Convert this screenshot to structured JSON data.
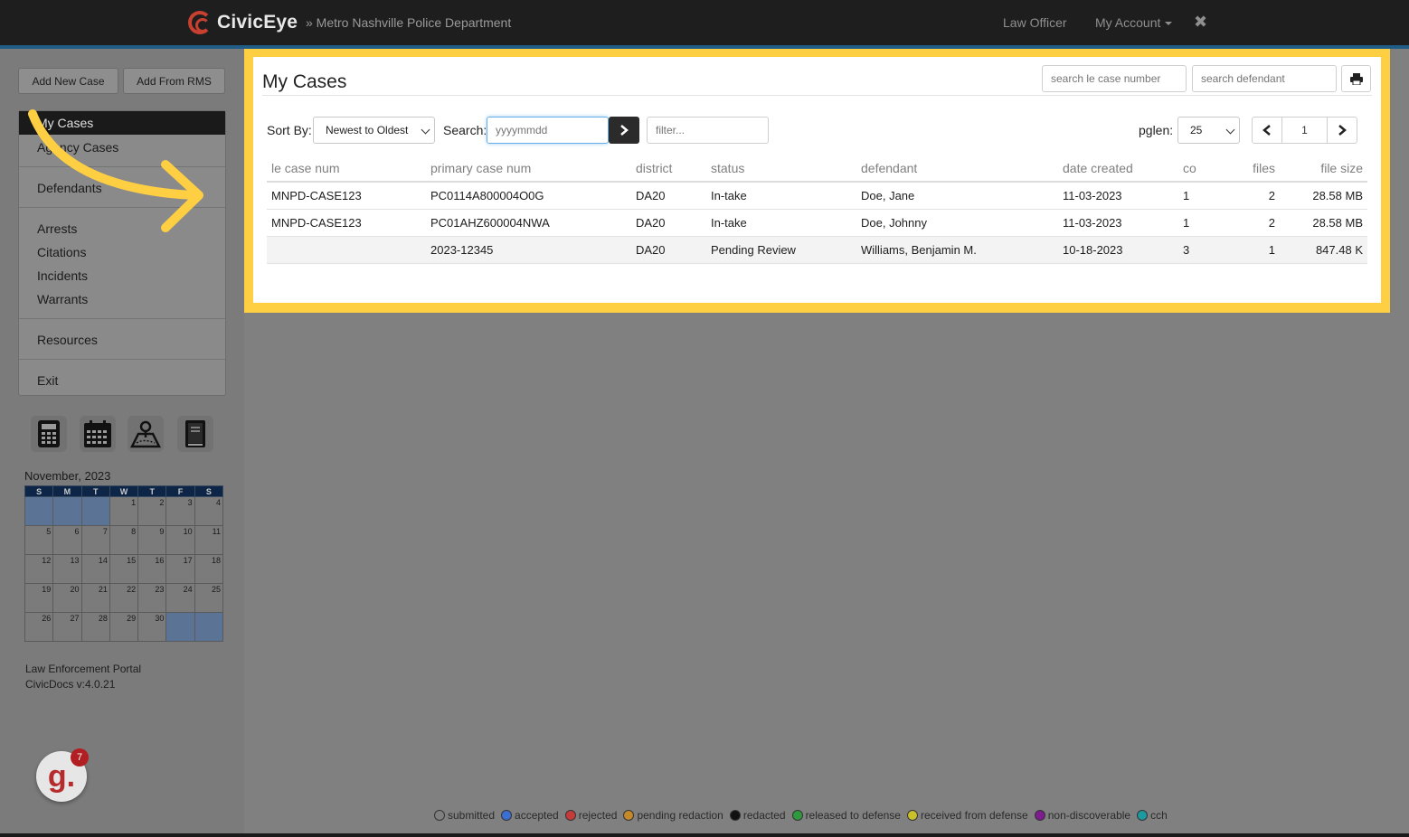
{
  "header": {
    "brand": "CivicEye",
    "department": "» Metro Nashville Police Department",
    "role": "Law Officer",
    "account": "My Account",
    "close_glyph": "✖"
  },
  "sidebar": {
    "add_new_case": "Add New Case",
    "add_from_rms": "Add From RMS",
    "menu": [
      {
        "label": "My Cases"
      },
      {
        "label": "Agency Cases"
      },
      {
        "label": "Defendants"
      },
      {
        "label": "Arrests"
      },
      {
        "label": "Citations"
      },
      {
        "label": "Incidents"
      },
      {
        "label": "Warrants"
      },
      {
        "label": "Resources"
      },
      {
        "label": "Exit"
      }
    ],
    "tools": [
      "calculator-icon",
      "calendar-icon",
      "map-icon",
      "book-icon"
    ],
    "calendar": {
      "title": "November, 2023",
      "days": [
        "S",
        "M",
        "T",
        "W",
        "T",
        "F",
        "S"
      ],
      "weeks": [
        [
          "",
          "",
          "",
          "1",
          "2",
          "3",
          "4"
        ],
        [
          "5",
          "6",
          "7",
          "8",
          "9",
          "10",
          "11"
        ],
        [
          "12",
          "13",
          "14",
          "15",
          "16",
          "17",
          "18"
        ],
        [
          "19",
          "20",
          "21",
          "22",
          "23",
          "24",
          "25"
        ],
        [
          "26",
          "27",
          "28",
          "29",
          "30",
          "",
          ""
        ]
      ]
    },
    "footer_line1": "Law Enforcement Portal",
    "footer_line2": "CivicDocs v:4.0.21",
    "badge_letter": "g.",
    "badge_count": "7"
  },
  "main": {
    "title": "My Cases",
    "search_case_placeholder": "search le case number",
    "search_defendant_placeholder": "search defendant",
    "sort_label": "Sort By:",
    "sort_value": "Newest to Oldest",
    "search_label": "Search:",
    "date_placeholder": "yyyymmdd",
    "filter_placeholder": "filter...",
    "pglen_label": "pglen:",
    "pglen_value": "25",
    "page_number": "1",
    "columns": [
      "le case num",
      "primary case num",
      "district",
      "status",
      "defendant",
      "date created",
      "co",
      "files",
      "file size"
    ],
    "rows": [
      {
        "le": "MNPD-CASE123",
        "primary": "PC0114A800004O0G",
        "district": "DA20",
        "status": "In-take",
        "defendant": "Doe, Jane",
        "date": "11-03-2023",
        "co": "1",
        "files": "2",
        "size": "28.58 MB"
      },
      {
        "le": "MNPD-CASE123",
        "primary": "PC01AHZ600004NWA",
        "district": "DA20",
        "status": "In-take",
        "defendant": "Doe, Johnny",
        "date": "11-03-2023",
        "co": "1",
        "files": "2",
        "size": "28.58 MB"
      },
      {
        "le": "",
        "primary": "2023-12345",
        "district": "DA20",
        "status": "Pending Review",
        "defendant": "Williams, Benjamin M.",
        "date": "10-18-2023",
        "co": "3",
        "files": "1",
        "size": "847.48 K"
      }
    ]
  },
  "legend": [
    {
      "label": "submitted",
      "color": "#808080"
    },
    {
      "label": "accepted",
      "color": "#3b6fd1"
    },
    {
      "label": "rejected",
      "color": "#c73a3a"
    },
    {
      "label": "pending redaction",
      "color": "#c48a2a"
    },
    {
      "label": "redacted",
      "color": "#111111"
    },
    {
      "label": "released to defense",
      "color": "#2f9a3c"
    },
    {
      "label": "received from defense",
      "color": "#c9c02a"
    },
    {
      "label": "non-discoverable",
      "color": "#7d1b8f"
    },
    {
      "label": "cch",
      "color": "#1b9aa0"
    }
  ],
  "colors": {
    "highlight": "#fecf42",
    "annotation_arrow": "#fecf42",
    "nav_bg": "#1e1e1e",
    "overlay_gray": "#808080"
  }
}
